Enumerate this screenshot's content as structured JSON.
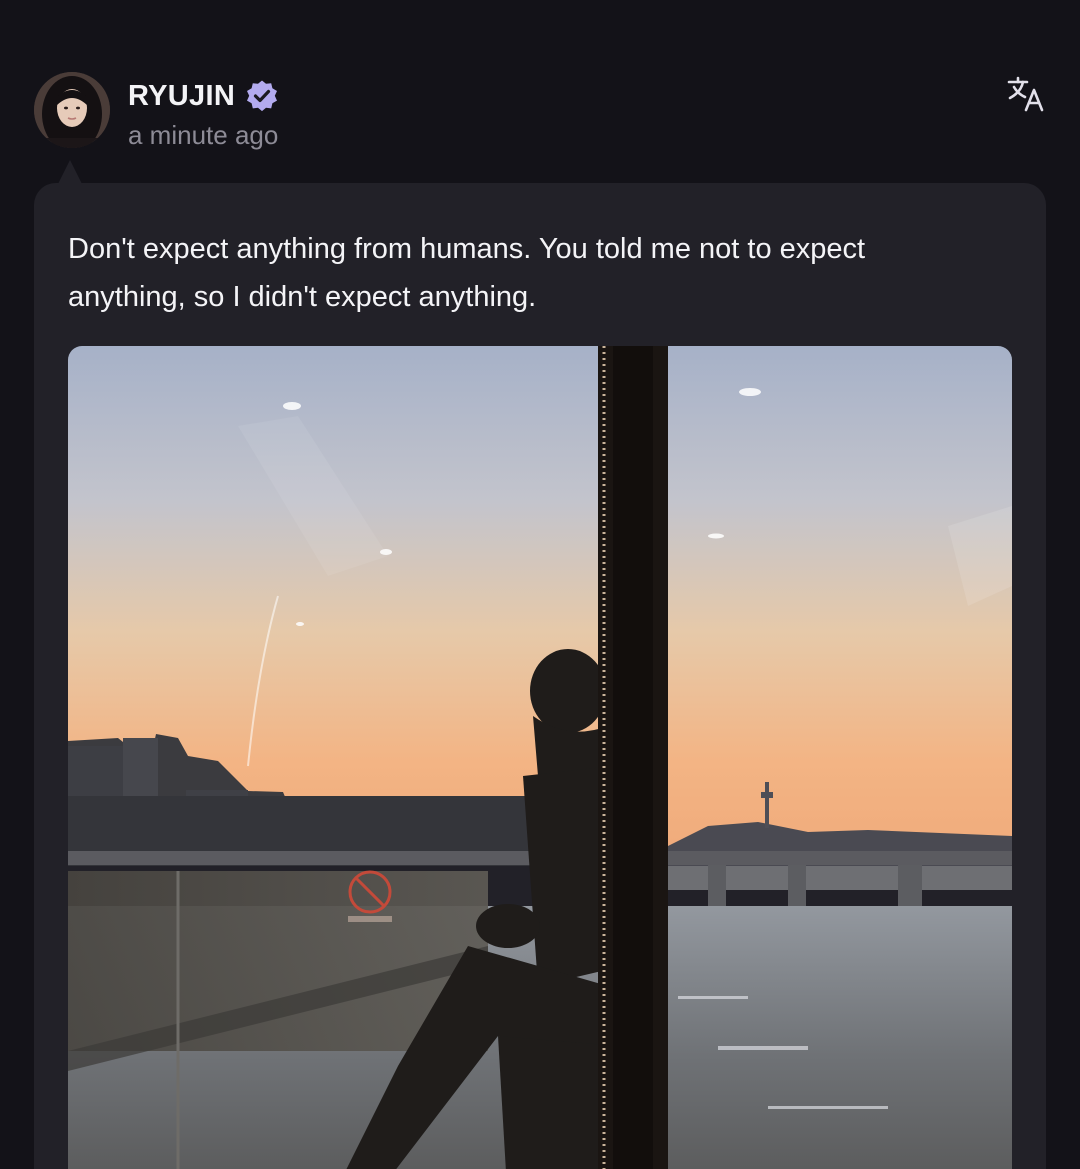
{
  "post": {
    "author": {
      "name": "RYUJIN",
      "verified": true,
      "avatar_icon": "profile-photo"
    },
    "timestamp": "a minute ago",
    "text": "Don't expect anything from humans. You told me not to expect anything, so I didn't expect anything.",
    "image_description_icon": "photo-silhouette-river-sunset"
  },
  "icons": {
    "verified": "verified-badge-icon",
    "translate": "translate-icon"
  },
  "colors": {
    "background": "#131218",
    "card": "#222128",
    "verified_badge": "#b3abef",
    "username": "#f3f3f6",
    "timestamp": "#8d8b96"
  }
}
